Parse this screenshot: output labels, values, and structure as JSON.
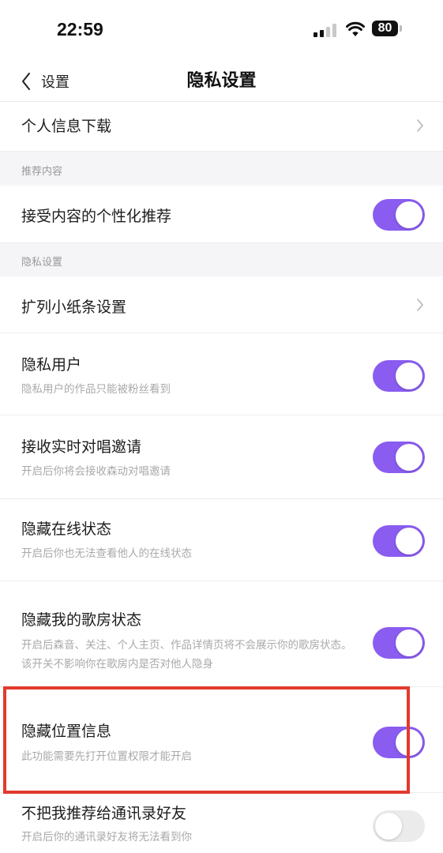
{
  "status_bar": {
    "time": "22:59",
    "battery": "80"
  },
  "nav": {
    "back_label": "设置",
    "title": "隐私设置"
  },
  "rows": {
    "personal_info_download": {
      "title": "个人信息下载"
    },
    "section_recommend": {
      "label": "推荐内容"
    },
    "personalized_recommend": {
      "title": "接受内容的个性化推荐",
      "enabled": true
    },
    "section_privacy": {
      "label": "隐私设置"
    },
    "note_settings": {
      "title": "扩列小纸条设置"
    },
    "private_user": {
      "title": "隐私用户",
      "subtitle": "隐私用户的作品只能被粉丝看到",
      "enabled": true
    },
    "realtime_duet": {
      "title": "接收实时对唱邀请",
      "subtitle": "开启后你将会接收森动对唱邀请",
      "enabled": true
    },
    "hide_online": {
      "title": "隐藏在线状态",
      "subtitle": "开启后你也无法查看他人的在线状态",
      "enabled": true
    },
    "hide_room_status": {
      "title": "隐藏我的歌房状态",
      "subtitle": "开启后森音、关注、个人主页、作品详情页将不会展示你的歌房状态。该开关不影响你在歌房内是否对他人隐身",
      "enabled": true
    },
    "hide_location": {
      "title": "隐藏位置信息",
      "subtitle": "此功能需要先打开位置权限才能开启",
      "enabled": true
    },
    "contacts_recommend": {
      "title": "不把我推荐给通讯录好友",
      "subtitle": "开启后你的通讯录好友将无法看到你",
      "enabled": false
    }
  },
  "colors": {
    "toggle_on": "#8a5cf0",
    "toggle_off": "#ebebeb",
    "highlight": "#e23a2e"
  }
}
